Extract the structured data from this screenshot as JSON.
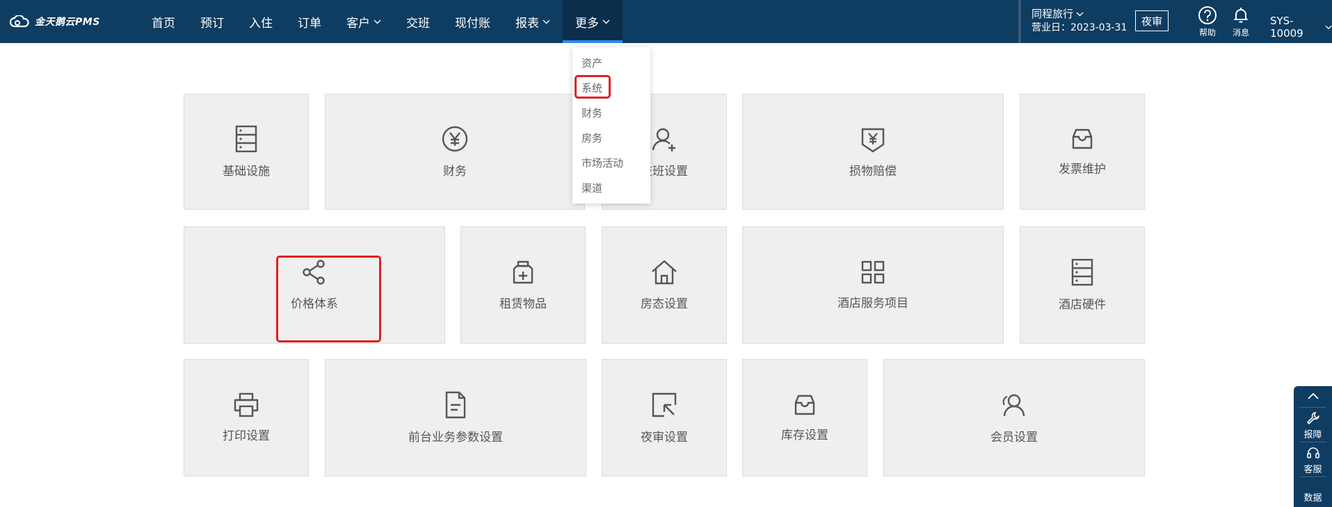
{
  "app": {
    "logo_text": "金天鹅云PMS"
  },
  "nav": {
    "items": [
      {
        "label": "首页"
      },
      {
        "label": "预订"
      },
      {
        "label": "入住"
      },
      {
        "label": "订单"
      },
      {
        "label": "客户"
      },
      {
        "label": "交班"
      },
      {
        "label": "现付账"
      },
      {
        "label": "报表"
      },
      {
        "label": "更多"
      }
    ],
    "active": "更多"
  },
  "header": {
    "hotel_name": "同程旅行",
    "business_date": "营业日：2023-03-31",
    "night_audit_label": "夜审",
    "help_label": "帮助",
    "messages_label": "消息",
    "user_label": "SYS-10009"
  },
  "more_menu": {
    "items": [
      "资产",
      "系统",
      "财务",
      "房务",
      "市场活动",
      "渠道"
    ],
    "highlighted": "系统"
  },
  "tiles": {
    "infrastructure": "基础设施",
    "finance": "财务",
    "shift_settings": "交班设置",
    "damage_comp": "损物赔偿",
    "invoice": "发票维护",
    "price_system": "价格体系",
    "rental": "租赁物品",
    "room_status": "房态设置",
    "hotel_services": "酒店服务项目",
    "hotel_hardware": "酒店硬件",
    "print": "打印设置",
    "frontdesk_params": "前台业务参数设置",
    "night_audit_settings": "夜审设置",
    "inventory": "库存设置",
    "member": "会员设置"
  },
  "side_dock": {
    "report_label": "报障",
    "service_label": "客服",
    "data_label": "数据"
  },
  "colors": {
    "topbar": "#0f3c61",
    "tile_bg": "#efefef",
    "highlight": "#e02020"
  }
}
